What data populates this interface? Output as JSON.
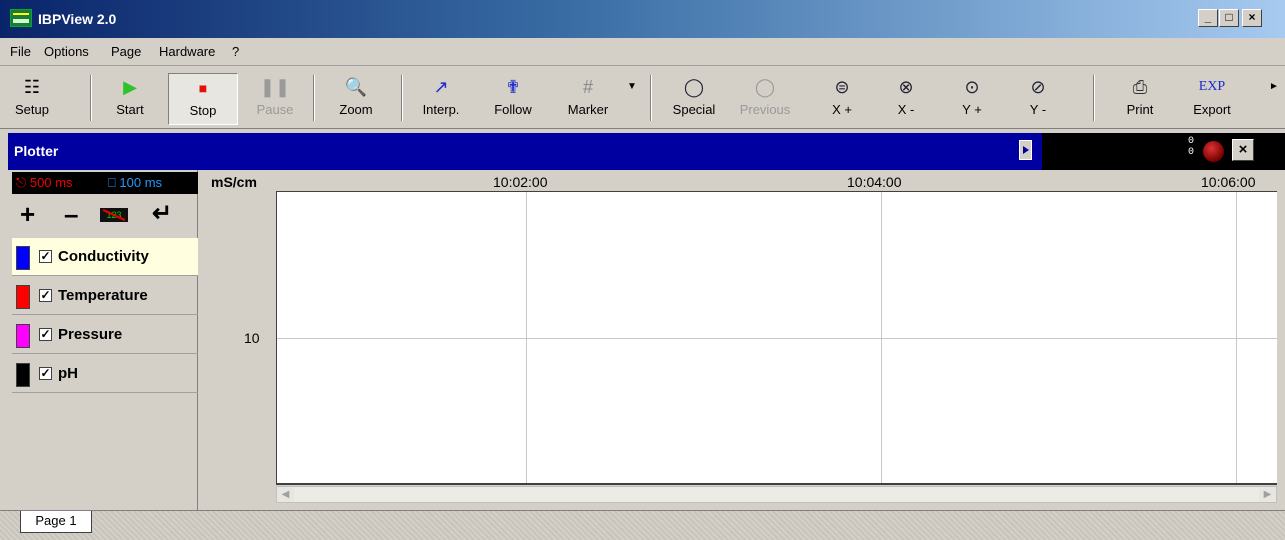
{
  "window": {
    "title": "IBPView 2.0",
    "minimize": "_",
    "maximize": "□",
    "close": "×"
  },
  "menu": [
    "File",
    "Options",
    "Page",
    "Hardware",
    "?"
  ],
  "toolbar": {
    "setup": "Setup",
    "start": "Start",
    "stop": "Stop",
    "pause": "Pause",
    "zoom": "Zoom",
    "interp": "Interp.",
    "follow": "Follow",
    "marker": "Marker",
    "special": "Special",
    "previous": "Previous",
    "x_plus": "X +",
    "x_minus": "X -",
    "y_plus": "Y +",
    "y_minus": "Y -",
    "print": "Print",
    "export": "Export",
    "export_icon": "EXP"
  },
  "plotter": {
    "title": "Plotter",
    "counter_top": "0",
    "counter_bottom": "0"
  },
  "left_panel": {
    "sample_rate": "500 ms",
    "display_rate": "100 ms",
    "lcd_label": "123",
    "channels": [
      {
        "name": "Conductivity",
        "color": "#0000ff",
        "checked": true
      },
      {
        "name": "Temperature",
        "color": "#ff0000",
        "checked": true
      },
      {
        "name": "Pressure",
        "color": "#ff00ff",
        "checked": true
      },
      {
        "name": "pH",
        "color": "#000000",
        "checked": true
      }
    ]
  },
  "chart": {
    "unit": "mS/cm",
    "time_labels": [
      "10:02:00",
      "10:04:00",
      "10:06:00"
    ],
    "y_tick": "10"
  },
  "tabs": {
    "page1": "Page 1"
  }
}
